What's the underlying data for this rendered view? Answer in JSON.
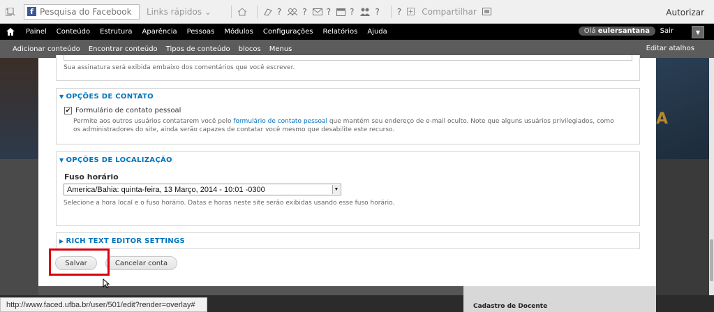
{
  "fbbar": {
    "search_placeholder": "Pesquisa do Facebook",
    "quick_links": "Links rápidos",
    "q_marks": [
      "?",
      "?",
      "?",
      "?",
      "?"
    ],
    "help": "?",
    "share": "Compartilhar",
    "authorize": "Autorizar"
  },
  "toolbar": {
    "items": [
      "Painel",
      "Conteúdo",
      "Estrutura",
      "Aparência",
      "Pessoas",
      "Módulos",
      "Configurações",
      "Relatórios",
      "Ajuda"
    ],
    "greeting": "Olá",
    "username": "eulersantana",
    "logout": "Sair"
  },
  "shortcuts": {
    "items": [
      "Adicionar conteúdo",
      "Encontrar conteúdo",
      "Tipos de conteúdo",
      "blocos",
      "Menus"
    ],
    "edit": "Editar atalhos"
  },
  "form": {
    "signature_desc": "Sua assinatura será exibida embaixo dos comentários que você escrever.",
    "contact": {
      "legend": "OPÇÕES DE CONTATO",
      "checkbox_label": "Formulário de contato pessoal",
      "checked": true,
      "desc_before": "Permite aos outros usuários contatarem você pelo ",
      "desc_link": "formulário de contato pessoal",
      "desc_after": " que mantém seu endereço de e-mail oculto. Note que alguns usuários privilegiados, como os administradores do site, ainda serão capazes de contatar você mesmo que desabilite este recurso."
    },
    "locale": {
      "legend": "OPÇÕES DE LOCALIZAÇÃO",
      "label": "Fuso horário",
      "timezone": "America/Bahia: quinta-feira, 13 Março, 2014 - 10:01 -0300",
      "desc": "Selecione a hora local e o fuso horário. Datas e horas neste site serão exibidas usando esse fuso horário."
    },
    "rte": {
      "legend": "RICH TEXT EDITOR SETTINGS"
    },
    "save_label": "Salvar",
    "cancel_label": "Cancelar conta"
  },
  "background": {
    "right_bottom_text": "Cadastro de Docente"
  },
  "statusbar": {
    "url": "http://www.faced.ufba.br/user/501/edit?render=overlay#"
  }
}
